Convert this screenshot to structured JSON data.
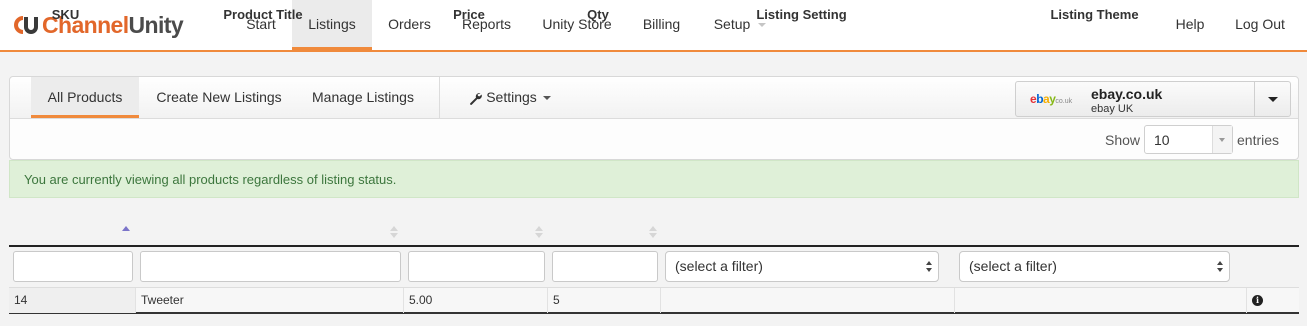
{
  "app": {
    "logo_part1": "Channel",
    "logo_part2": "Unity",
    "brand_color": "#e2672a"
  },
  "nav": {
    "items": [
      {
        "label": "Start"
      },
      {
        "label": "Listings",
        "active": true
      },
      {
        "label": "Orders"
      },
      {
        "label": "Reports"
      },
      {
        "label": "Unity Store"
      },
      {
        "label": "Billing"
      },
      {
        "label": "Setup",
        "has_dropdown": true
      }
    ],
    "help": "Help",
    "logout": "Log Out"
  },
  "subtabs": {
    "all_products": "All Products",
    "create_new_listings": "Create New Listings",
    "manage_listings": "Manage Listings",
    "settings": "Settings",
    "settings_icon": "wrench-icon"
  },
  "marketplace": {
    "logo_text": [
      "e",
      "b",
      "a",
      "y"
    ],
    "logo_domain": "co.uk",
    "name": "ebay.co.uk",
    "subtitle": "ebay UK"
  },
  "entries": {
    "show_label": "Show",
    "value": "10",
    "suffix": "entries"
  },
  "alert": {
    "text": "You are currently viewing all products regardless of listing status."
  },
  "table": {
    "columns": [
      "SKU",
      "Product Title",
      "Price",
      "Qty",
      "Listing Setting",
      "Listing Theme"
    ],
    "sorted_column": "SKU",
    "filter_placeholder": "(select a filter)",
    "rows": [
      {
        "sku": "14",
        "title": "Tweeter",
        "price": "5.00",
        "qty": "5",
        "setting": "",
        "theme": ""
      }
    ],
    "row_action_icon": "info-icon"
  }
}
